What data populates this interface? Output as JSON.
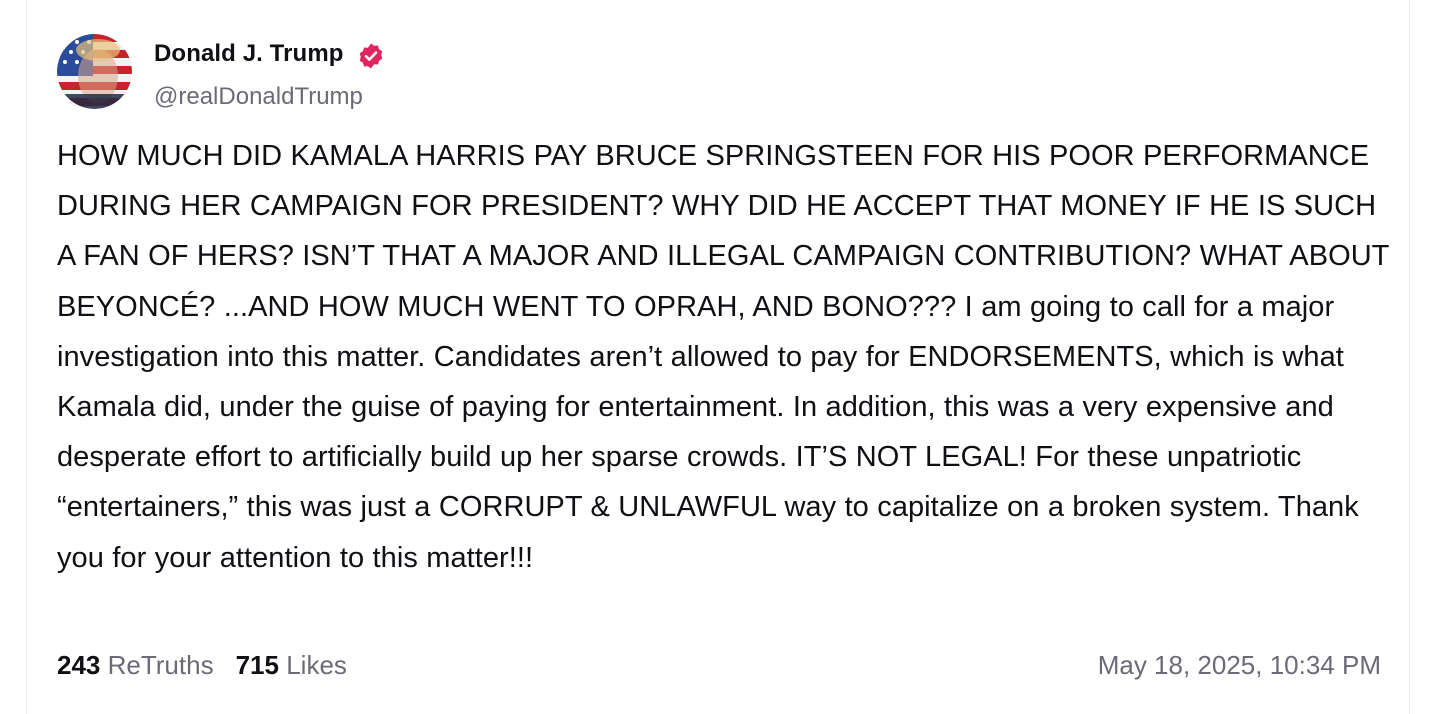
{
  "post": {
    "author": {
      "display_name": "Donald J. Trump",
      "handle": "@realDonaldTrump",
      "verified": true,
      "verified_color": "#e0245e"
    },
    "body": "HOW MUCH DID KAMALA HARRIS PAY BRUCE SPRINGSTEEN FOR HIS POOR PERFORMANCE DURING HER CAMPAIGN FOR PRESIDENT? WHY DID HE ACCEPT THAT MONEY IF HE IS SUCH A FAN OF HERS? ISN’T THAT A MAJOR AND ILLEGAL CAMPAIGN CONTRIBUTION? WHAT ABOUT BEYONCÉ? ...AND HOW MUCH WENT TO OPRAH, AND BONO??? I am going to call for a major investigation into this matter. Candidates aren’t allowed to pay for ENDORSEMENTS, which is what Kamala did, under the guise of paying for entertainment. In addition, this was a very expensive and desperate effort to artificially build up her sparse crowds. IT’S NOT LEGAL! For these unpatriotic “entertainers,” this was just a CORRUPT & UNLAWFUL way to capitalize on a broken system. Thank you for your attention to this matter!!!",
    "stats": {
      "retruths_count": "243",
      "retruths_label": "ReTruths",
      "likes_count": "715",
      "likes_label": "Likes"
    },
    "timestamp": "May 18, 2025, 10:34 PM"
  },
  "icons": {
    "avatar": "avatar-flag-portrait",
    "verified": "verified-badge-icon"
  }
}
